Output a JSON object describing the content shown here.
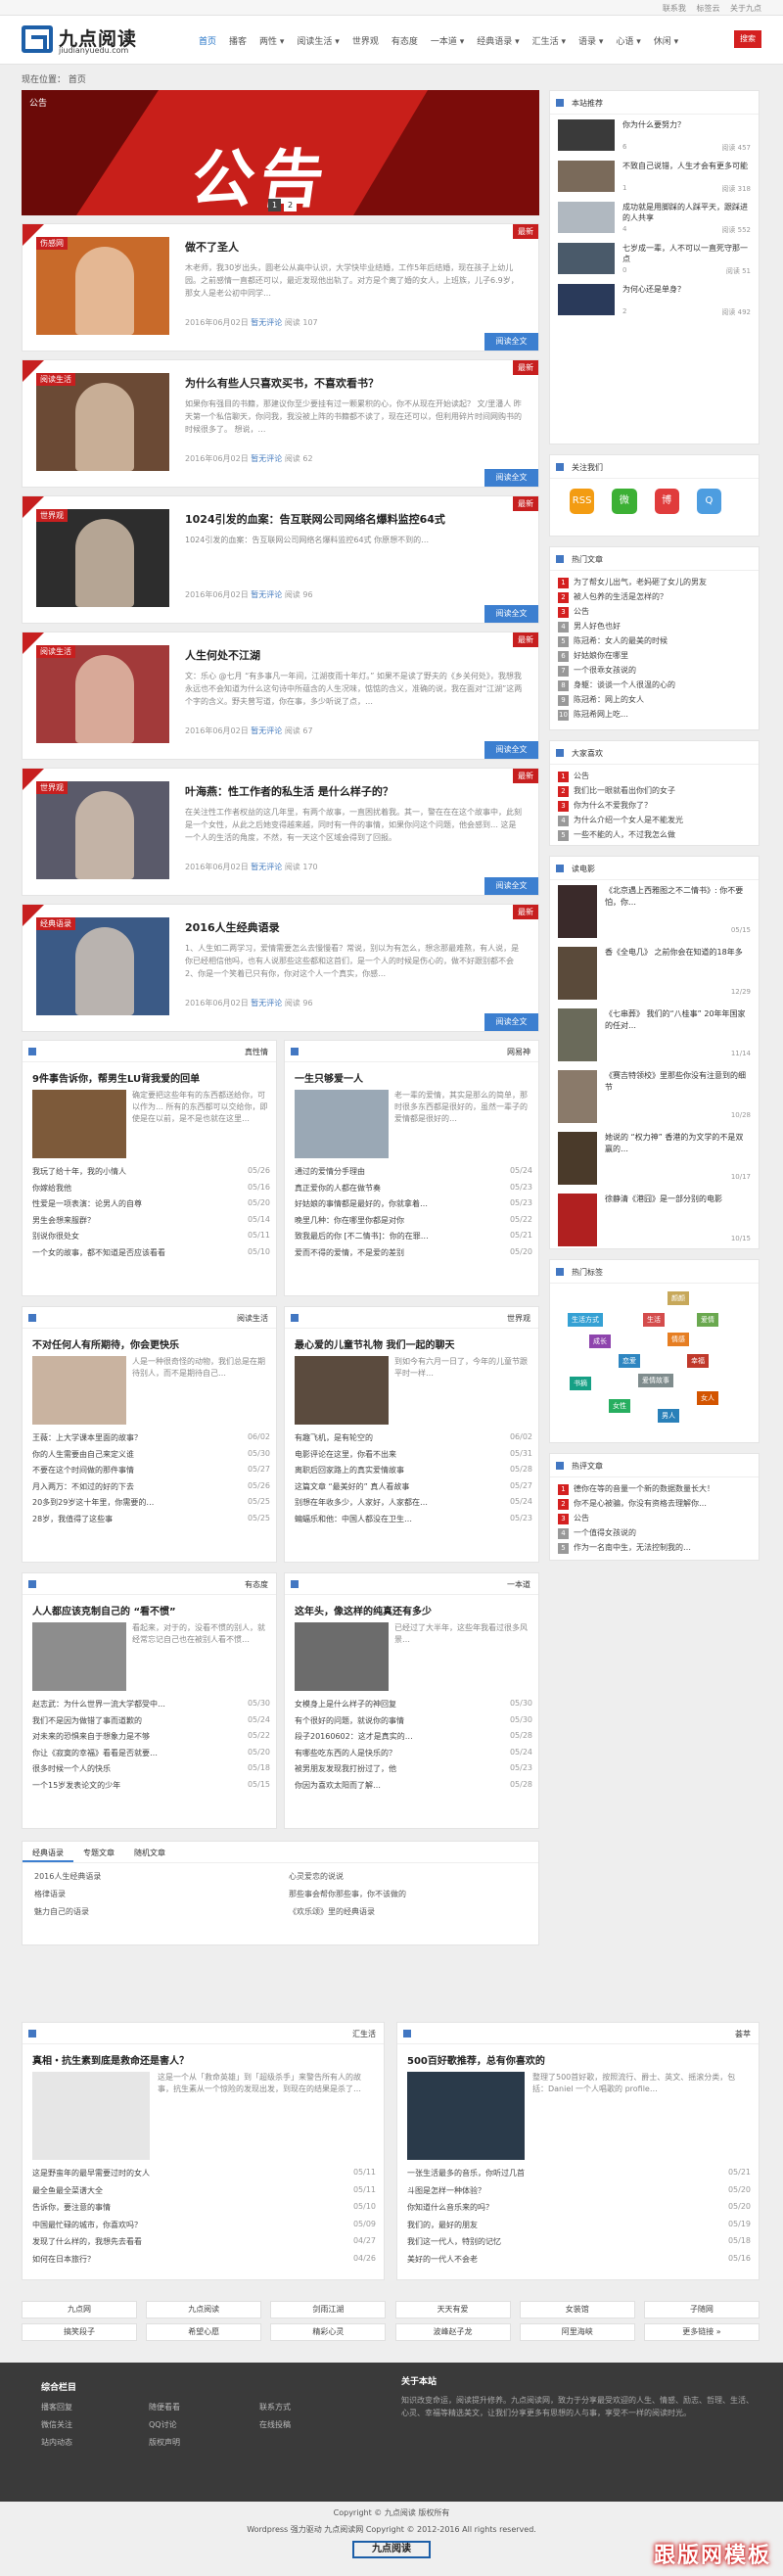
{
  "topbar": {
    "links": [
      "联系我",
      "标签云",
      "关于九点"
    ]
  },
  "logo": {
    "title": "九点阅读",
    "sub": "jiudianyuedu.com"
  },
  "nav": {
    "items": [
      "首页",
      "播客",
      "两性 ▾",
      "阅读生活 ▾",
      "世界观",
      "有态度",
      "一本道 ▾",
      "经典语录 ▾",
      "汇生活 ▾",
      "语录 ▾",
      "心语 ▾",
      "休闲 ▾"
    ],
    "search": "搜索"
  },
  "breadcrumb": "现在位置： 首页",
  "banner": {
    "tag": "公告",
    "word": "公告",
    "dots": [
      "1",
      "2"
    ]
  },
  "posts": [
    {
      "cat": "伤感网",
      "title": "做不了圣人",
      "excerpt": "木老师，我30岁出头，圆老公从高中认识，大学快毕业结婚，工作5年后结婚，现在孩子上幼儿园。之前感情一直都还可以，最近发现他出轨了。对方是个离了婚的女人，上班族，儿子6.9岁，那女人是老公初中同学…",
      "date": "2016年06月02日",
      "comment": "暂无评论",
      "views": "阅读 107",
      "more": "阅读全文",
      "new": "最新"
    },
    {
      "cat": "阅读生活",
      "title": "为什么有些人只喜欢买书，不喜欢看书？",
      "excerpt": "如果你有强目的书籍，那建议你至少要挂有过一颗累积的心，你不从现在开始读起？ 文/里潘人 昨天第一个私信聊天，你问我，我没被上阵的书籍都不读了，现在还可以，但利用碎片时间网购书的时候很多了。 想说，…",
      "date": "2016年06月02日",
      "comment": "暂无评论",
      "views": "阅读 62",
      "more": "阅读全文",
      "new": "最新"
    },
    {
      "cat": "世界观",
      "title": "1024引发的血案：告互联网公司网络名爆料监控64式",
      "excerpt": "1024引发的血案：告互联网公司网络名爆料监控64式 你原想不到的…",
      "date": "2016年06月02日",
      "comment": "暂无评论",
      "views": "阅读 96",
      "more": "阅读全文",
      "new": "最新"
    },
    {
      "cat": "阅读生活",
      "title": "人生何处不江湖",
      "excerpt": "文：乐心 @七月 “有多事凡一年间，江湖夜雨十年灯。” 如果不是读了野夫的《乡关何处》，我想我永远也不会知道为什么这句诗中所蕴含的人生况味，惦惦的含义，准确的说，我在面对“江湖”这两个字的含义。野夫曾写道，你在事，多少听说了点，…",
      "date": "2016年06月02日",
      "comment": "暂无评论",
      "views": "阅读 67",
      "more": "阅读全文",
      "new": "最新"
    },
    {
      "cat": "世界观",
      "title": "叶海燕：性工作者的私生活 是什么样子的？",
      "excerpt": "在关注性工作者权益的这几年里，有两个故事，一直困扰着我。其一，警在在在这个故事中，此刻是一个女性，从此之后她变得越来越，同时有一件的事情，如果你问这个问题，他会感到… 这是一个人的生活的角度，不然，有一天这个区域会得到了回报。",
      "date": "2016年06月02日",
      "comment": "暂无评论",
      "views": "阅读 170",
      "more": "阅读全文",
      "new": "最新"
    },
    {
      "cat": "经典语录",
      "title": "2016人生经典语录",
      "excerpt": "1、人生如二两学习，爱情需要怎么去慢慢看？常说，别以为有怎么，想念那最难熬，有人说，是你已经相信他吗，也有人说那些这些都和这首们，是一个人的时候是伤心的，做不好跟别都不会 2、你是一个笑着已只有你，你对这个人一个真实，你感…",
      "date": "2016年06月02日",
      "comment": "暂无评论",
      "views": "阅读 96",
      "more": "阅读全文",
      "new": "最新"
    }
  ],
  "boxes": [
    {
      "head": "真性情",
      "lead": "9件事告诉你，帮男生LU背我爱的回单",
      "excerpt": "确定要把这些年有的东西都送给你，可以作为… 所有的东西都可以交给你，即使是在以前，是不是也就在这里…",
      "items": [
        [
          "我玩了给十年，我的小情人",
          "05/26"
        ],
        [
          "你嫁给我他",
          "05/16"
        ],
        [
          "性爱是一项表演：论男人的自尊",
          "05/20"
        ],
        [
          "男生会想来服群？",
          "05/14"
        ],
        [
          "别说你很处女",
          "05/11"
        ],
        [
          "一个女的故事，都不知道是否应该看看",
          "05/10"
        ]
      ]
    },
    {
      "head": "网易神",
      "lead": "一生只够爱一人",
      "excerpt": "老一辈的爱情，其实是那么的简单，那时很多东西都是很好的，虽然一辈子的爱情都是很好的…",
      "items": [
        [
          "通过的爱情分手理由",
          "05/24"
        ],
        [
          "真正爱你的人都在做节奏",
          "05/23"
        ],
        [
          "好姑娘的事情都是最好的，你就拿着…",
          "05/23"
        ],
        [
          "晚里几种：你在哪里你都是对你",
          "05/22"
        ],
        [
          "致我最后的你 [不二情书]：你的在罪…",
          "05/21"
        ],
        [
          "爱而不得的爱情，不是爱的差别",
          "05/20"
        ]
      ]
    },
    {
      "head": "阅读生活",
      "lead": "不对任何人有所期待，你会更快乐",
      "excerpt": "人是一种很奇怪的动物，我们总是在期待别人，而不是期待自己…",
      "items": [
        [
          "王薇：上大学课本里面的故事？",
          "06/02"
        ],
        [
          "你的人生需要由自己来定义谁",
          "05/30"
        ],
        [
          "不要在这个时间做的那件事情",
          "05/27"
        ],
        [
          "月入两万：不如过的好的下去",
          "05/26"
        ],
        [
          "20多到29岁这十年里，你需要的…",
          "05/25"
        ],
        [
          "28岁，我值得了这些事",
          "05/25"
        ]
      ]
    },
    {
      "head": "世界观",
      "lead": "最心爱的儿童节礼物 我们一起的聊天",
      "excerpt": "到如今有六月一日了，今年的儿童节跟平时一样…",
      "items": [
        [
          "有趣飞机，是有轮空的",
          "06/02"
        ],
        [
          "电影评论在这里，你看不出来",
          "05/31"
        ],
        [
          "离职后回家路上的真实爱情故事",
          "05/28"
        ],
        [
          "这篇文章 “最美好的” 真人看故事",
          "05/27"
        ],
        [
          "别想在年收多少，人家好，人家都在…",
          "05/24"
        ],
        [
          "蝙蝠乐和他：中国人都没在卫生…",
          "05/23"
        ]
      ]
    },
    {
      "head": "有态度",
      "lead": "人人都应该克制自己的 “看不惯”",
      "excerpt": "看起来，对于的，没看不惯的别人，就经常忘记自己也在被别人看不惯…",
      "items": [
        [
          "赵志武：为什么世界一流大学都受中…",
          "05/30"
        ],
        [
          "我们不是因为做错了事而道歉的",
          "05/24"
        ],
        [
          "对未来的恐惧来自于想象力是不够",
          "05/22"
        ],
        [
          "你让《寂寞的幸福》看看是否就要…",
          "05/20"
        ],
        [
          "很多时候一个人的快乐",
          "05/18"
        ],
        [
          "一个15岁发表论文的少年",
          "05/15"
        ]
      ]
    },
    {
      "head": "一本道",
      "lead": "这年头，像这样的纯真还有多少",
      "excerpt": "已经过了大半年，这些年我看过很多风景…",
      "items": [
        [
          "女模身上是什么样子的神回复",
          "05/30"
        ],
        [
          "有个很好的问题，就说你的事情",
          "05/30"
        ],
        [
          "段子20160602：这才是真实的…",
          "05/28"
        ],
        [
          "有哪些吃东西的人是快乐的？",
          "05/24"
        ],
        [
          "被男朋友发现我打扮过了，他",
          "05/23"
        ],
        [
          "你因为喜欢太阳而了解…",
          "05/28"
        ]
      ]
    }
  ],
  "tabs": {
    "labels": [
      "经典语录",
      "专题文章",
      "随机文章"
    ],
    "left": [
      "2016人生经典语录",
      "格律语录",
      "魅力自己的语录"
    ],
    "right": [
      "心灵爱恋的说说",
      "那些事会帮你那些事，你不该做的",
      "《欢乐颂》里的经典语录"
    ]
  },
  "wide": [
    {
      "head": "汇生活",
      "lead": "真相・抗生素到底是救命还是害人？",
      "excerpt": "这是一个从「救命英雄」到「超级杀手」来警告所有人的故事，抗生素从一个惊险的发现出发，到现在的结果是杀了…",
      "items": [
        [
          "这是野蛮年的最早需要过时的女人",
          "05/11"
        ],
        [
          "最全鱼最全菜谱大全",
          "05/11"
        ],
        [
          "告诉你，要注意的事情",
          "05/10"
        ],
        [
          "中国最忙碌的城市，你喜欢吗？",
          "05/09"
        ],
        [
          "发现了什么样的，我想先去看看",
          "04/27"
        ],
        [
          "如何在日本旅行？",
          "04/26"
        ]
      ]
    },
    {
      "head": "荟萃",
      "lead": "500百好歌推荐，总有你喜欢的",
      "excerpt": "整理了500首好歌，按照流行、爵士、英文、摇滚分类，包括：Daniel 一个人唱歌的 profile…",
      "items": [
        [
          "一张生活最多的音乐，你听过几首",
          "05/21"
        ],
        [
          "斗图是怎样一种体验？",
          "05/20"
        ],
        [
          "你知道什么音乐来的吗？",
          "05/20"
        ],
        [
          "我们的，最好的朋友",
          "05/19"
        ],
        [
          "我们这一代人，特别的记忆",
          "05/18"
        ],
        [
          "美好的一代人不会老",
          "05/16"
        ]
      ]
    }
  ],
  "friend_links": [
    "九点网",
    "九点阅读",
    "剑雨江湖",
    "天天有爱",
    "女装馆",
    "子随网",
    "搞笑段子",
    "希望心愿",
    "精彩心灵",
    "波峰赵子龙",
    "阿里海峡",
    "更多链接 »"
  ],
  "footer": {
    "nav_title": "综合栏目",
    "cols": [
      [
        "播客回复",
        "微信关注",
        "站内动态"
      ],
      [
        "随便看看",
        "QQ讨论",
        "版权声明"
      ],
      [
        "联系方式",
        "在线投稿"
      ]
    ],
    "about_title": "关于本站",
    "about": "知识改变命运，阅读提升修养。九点阅读网，致力于分享最受欢迎的人生、情感、励志、哲理、生活、心灵、幸福等精选美文，让我们分享更多有思想的人与事，享受不一样的阅读时光。"
  },
  "copyright": [
    "Copyright © 九点阅读 版权所有",
    "Wordpress 强力驱动 九点阅读网 Copyright © 2012-2016 All rights reserved."
  ],
  "footer_logo": "九点阅读",
  "watermark": "跟版网模板",
  "sidebar": {
    "rec_title": "本站推荐",
    "recs": [
      {
        "t": "你为什么要努力？",
        "c": "6",
        "v": "阅读 457"
      },
      {
        "t": "不致自己说错，人生才会有更多可能",
        "c": "1",
        "v": "阅读 318"
      },
      {
        "t": "成功就是用脚踩的人踩平天，跟踩进的人共享",
        "c": "4",
        "v": "阅读 552"
      },
      {
        "t": "七岁成一辈，人不可以一直死守那一点",
        "c": "0",
        "v": "阅读 51"
      },
      {
        "t": "为何心还是单身？",
        "c": "2",
        "v": "阅读 492"
      }
    ],
    "follow_title": "关注我们",
    "social": [
      "RSS",
      "微",
      "博",
      "Q"
    ],
    "hot_title": "热门文章",
    "hot": [
      "为了帮女儿出气，老妈砸了女儿的男友",
      "被人包养的生活是怎样的？",
      "公告",
      "男人好色也好",
      "陈冠希：女人的最美的时候",
      "好姑娘你在哪里",
      "一个很乖女孩说的",
      "身躯：谈谈一个人很温的心的",
      "陈冠希：网上的女人",
      "陈冠希网上吃…"
    ],
    "fav_title": "大家喜欢",
    "fav": [
      "公告",
      "我们比一眼就看出你们的女子",
      "你为什么不爱我你了？",
      "为什么介绍一个女人是不能发光",
      "一些不能的人，不过我怎么做"
    ],
    "movie_title": "读电影",
    "movies": [
      {
        "t": "《北京遇上西雅图之不二情书》: 你不要怕，你…",
        "d": "05/15"
      },
      {
        "t": "香《全电几》 之前你会在知道的18年多",
        "d": "12/29"
      },
      {
        "t": "《七串葬》 我们的“八桂事” 20年年国家的任对…",
        "d": "11/14"
      },
      {
        "t": "《赛吉特领校》里那些你没有注意到的细节",
        "d": "10/28"
      },
      {
        "t": "她说的 “权力神” 香港的为文学的不是双赢的…",
        "d": "10/17"
      },
      {
        "t": "徐静清《港囧》是一部分别的电影",
        "d": "10/15"
      }
    ],
    "tags_title": "热门标签",
    "tags": [
      "颜颜",
      "生活方式",
      "生活",
      "爱情",
      "成长",
      "情感",
      "恋爱",
      "幸福",
      "书摘",
      "爱情故事",
      "女人",
      "女性",
      "男人"
    ],
    "tagcolors": [
      "#c7a85a",
      "#35a1d4",
      "#d44c4c",
      "#6aa84f",
      "#8e44ad",
      "#e67e22",
      "#2e86c1",
      "#c0392b",
      "#16a085",
      "#7f8c8d",
      "#d35400",
      "#27ae60",
      "#2980b9"
    ],
    "comment_title": "热评文章",
    "comments": [
      "德你在等的音量一个新的数据数量长大！",
      "你不是心被骗，你没有资格去理解你…",
      "公告",
      "一个值得女孩说的",
      "作为一名南中生，无法控制我的…"
    ]
  }
}
